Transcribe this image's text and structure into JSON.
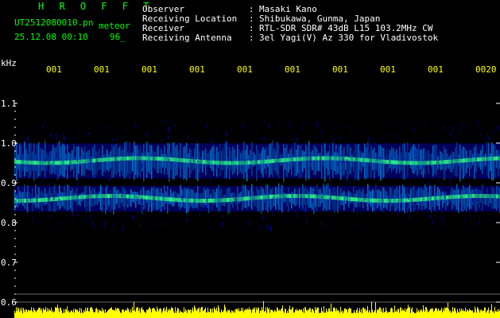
{
  "header": {
    "program_title": "H R O F F T",
    "file_name": "UT2512080010.pn",
    "mode": "meteor",
    "datetime": "25.12.08 00:10",
    "count": "96_",
    "fields": [
      {
        "label": "Observer",
        "sep": ":",
        "value": "Masaki Kano"
      },
      {
        "label": "Receiving Location",
        "sep": ":",
        "value": "Shibukawa, Gunma, Japan"
      },
      {
        "label": "Receiver",
        "sep": ":",
        "value": "RTL-SDR SDR# 43dB L15 103.2MHz CW"
      },
      {
        "label": "Receiving Antenna",
        "sep": ":",
        "value": "3el Yagi(V) Az 330 for Vladivostok"
      }
    ]
  },
  "chart_data": {
    "type": "heatmap",
    "title": "",
    "ylabel": "kHz",
    "y_tick_labels": [
      "1.1",
      "1.0",
      "0.9",
      "0.8",
      "0.7",
      "0.6"
    ],
    "y_ticks": [
      1.1,
      1.0,
      0.9,
      0.8,
      0.7,
      0.6
    ],
    "ylim": [
      0.6,
      1.1
    ],
    "x_tick_labels": [
      "001",
      "001",
      "001",
      "001",
      "001",
      "001",
      "001",
      "001",
      "001",
      "0020"
    ],
    "bands": [
      {
        "center_khz": 0.955,
        "intensity": "strong"
      },
      {
        "center_khz": 0.86,
        "intensity": "medium"
      }
    ],
    "colors": {
      "background": "#000000",
      "low": "#0000a0",
      "mid": "#00a0ff",
      "high": "#30ff80",
      "peak": "#ffff00"
    },
    "bottom_trace_color": "#ffff00"
  }
}
